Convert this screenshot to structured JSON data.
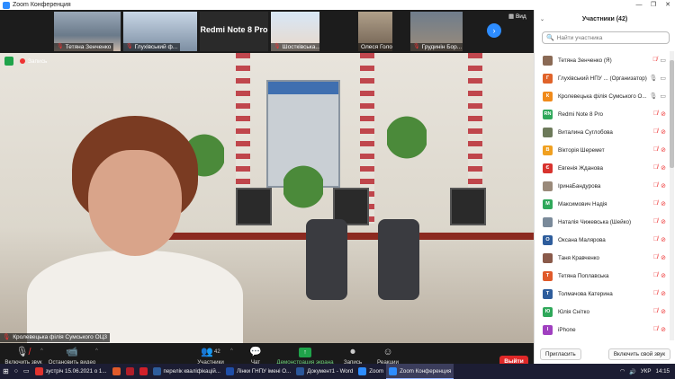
{
  "window": {
    "title": "Zoom Конференция",
    "controls": [
      "—",
      "❐",
      "✕"
    ]
  },
  "strip": {
    "thumbs": [
      {
        "name": "Тетяна Зенченко"
      },
      {
        "name": "Глухівський ф..."
      },
      {
        "name": "Redmi Note 8 Pro"
      },
      {
        "name": "Шостківська..."
      },
      {
        "name": "Олеся Голосюк"
      },
      {
        "name": "Грудинін Бор..."
      }
    ],
    "view_label": "Вид"
  },
  "video": {
    "recording_label": "Запись",
    "speaker_name": "Кролевецька філія Сумського ОЦ3"
  },
  "toolbar": {
    "unmute": "Включить звук",
    "stop_video": "Остановить видео",
    "participants": "Участники",
    "participants_count": "42",
    "chat": "Чат",
    "share": "Демонстрация экрана",
    "record": "Запись",
    "reactions": "Реакции",
    "leave": "Выйти"
  },
  "panel": {
    "title": "Участники (42)",
    "search_placeholder": "Найти участника",
    "participants": [
      {
        "name": "Тетяна Зенченко (Я)",
        "initial": "",
        "color": "#8a6a55",
        "mic": "muted",
        "cam": "on"
      },
      {
        "name": "Глухівський НПУ ... (Организатор)",
        "initial": "Г",
        "color": "#e0632a",
        "mic": "on",
        "cam": "on"
      },
      {
        "name": "Кролевецька філія Сумського О...",
        "initial": "К",
        "color": "#f08a1a",
        "mic": "on",
        "cam": "on"
      },
      {
        "name": "Redmi Note 8 Pro",
        "initial": "RN",
        "color": "#2fa85a",
        "mic": "muted",
        "cam": "off"
      },
      {
        "name": "Виталина Суглобова",
        "initial": "",
        "color": "#6d7a5a",
        "mic": "muted",
        "cam": "off"
      },
      {
        "name": "Вікторія Шеремет",
        "initial": "В",
        "color": "#f0a020",
        "mic": "muted",
        "cam": "off"
      },
      {
        "name": "Евгенія Жданова",
        "initial": "Є",
        "color": "#d8332e",
        "mic": "muted",
        "cam": "off"
      },
      {
        "name": "ІринаБандурова",
        "initial": "",
        "color": "#9a8a7a",
        "mic": "muted",
        "cam": "off"
      },
      {
        "name": "Максимович Надія",
        "initial": "М",
        "color": "#2fa85a",
        "mic": "muted",
        "cam": "off"
      },
      {
        "name": "Наталія Чижевська (Шейко)",
        "initial": "",
        "color": "#7a8a9a",
        "mic": "muted",
        "cam": "off"
      },
      {
        "name": "Оксана Малярова",
        "initial": "О",
        "color": "#2e5d9c",
        "mic": "muted",
        "cam": "off"
      },
      {
        "name": "Таня Кравченко",
        "initial": "",
        "color": "#8a5a4a",
        "mic": "muted",
        "cam": "off"
      },
      {
        "name": "Тетяна Поплавська",
        "initial": "Т",
        "color": "#e05a2a",
        "mic": "muted",
        "cam": "off"
      },
      {
        "name": "Толмачова Катерина",
        "initial": "Т",
        "color": "#2e5d9c",
        "mic": "muted",
        "cam": "off"
      },
      {
        "name": "Юлія Снітко",
        "initial": "Ю",
        "color": "#2fa85a",
        "mic": "muted",
        "cam": "off"
      },
      {
        "name": "iPhone",
        "initial": "I",
        "color": "#a040c0",
        "mic": "muted",
        "cam": "off"
      }
    ],
    "invite": "Пригласить",
    "unmute_self": "Включить свой звук"
  },
  "taskbar": {
    "items": [
      {
        "label": "зустріч 15.06.2021 о 1...",
        "color": "#e0332e",
        "active": false
      },
      {
        "label": "",
        "color": "#e05a2a",
        "active": false
      },
      {
        "label": "",
        "color": "#b01e2a",
        "active": false
      },
      {
        "label": "",
        "color": "#d0202a",
        "active": false
      },
      {
        "label": "перелік кваліфікацій...",
        "color": "#2e5d9c",
        "active": false
      },
      {
        "label": "Лінки ГНПУ імені О...",
        "color": "#1f4ea8",
        "active": false
      },
      {
        "label": "Документ1 - Word",
        "color": "#2b579a",
        "active": false
      },
      {
        "label": "Zoom",
        "color": "#2d8cff",
        "active": false
      },
      {
        "label": "Zoom Конференция",
        "color": "#2d8cff",
        "active": true
      }
    ],
    "lang": "УКР",
    "time": "14:15"
  }
}
